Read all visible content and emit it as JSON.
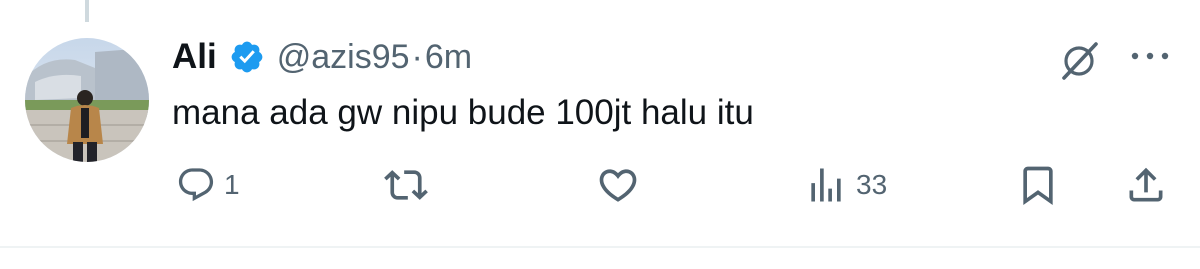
{
  "tweet": {
    "display_name": "Ali",
    "verified": true,
    "handle": "@azis95",
    "separator": "·",
    "time": "6m",
    "text": "mana ada gw nipu bude 100jt halu itu",
    "replies": "1",
    "views": "33"
  },
  "icons": {
    "reply": "speech-bubble-icon",
    "retweet": "retweet-arrows-icon",
    "like": "heart-icon",
    "views": "bar-chart-icon",
    "bookmark": "bookmark-icon",
    "share": "share-upload-icon",
    "grok": "grok-slash-icon",
    "more": "ellipsis-icon"
  },
  "colors": {
    "text": "#0f1419",
    "secondary": "#536471",
    "verified": "#1d9bf0",
    "divider": "#eff3f4"
  }
}
